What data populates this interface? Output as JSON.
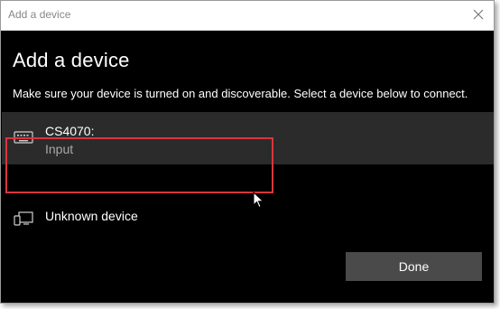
{
  "window": {
    "title": "Add a device",
    "close_icon": "close-icon"
  },
  "dialog": {
    "heading": "Add a device",
    "instructions": "Make sure your device is turned on and discoverable. Select a device below to connect."
  },
  "devices": [
    {
      "name": "CS4070:",
      "type": "Input",
      "icon": "keyboard-icon",
      "selected": true
    },
    {
      "name": "Unknown device",
      "type": "",
      "icon": "device-icon",
      "selected": false
    }
  ],
  "buttons": {
    "done_label": "Done"
  },
  "colors": {
    "background": "#000000",
    "selected_row": "#2b2b2b",
    "highlight": "#d9363e",
    "button": "#4a4a4a"
  }
}
